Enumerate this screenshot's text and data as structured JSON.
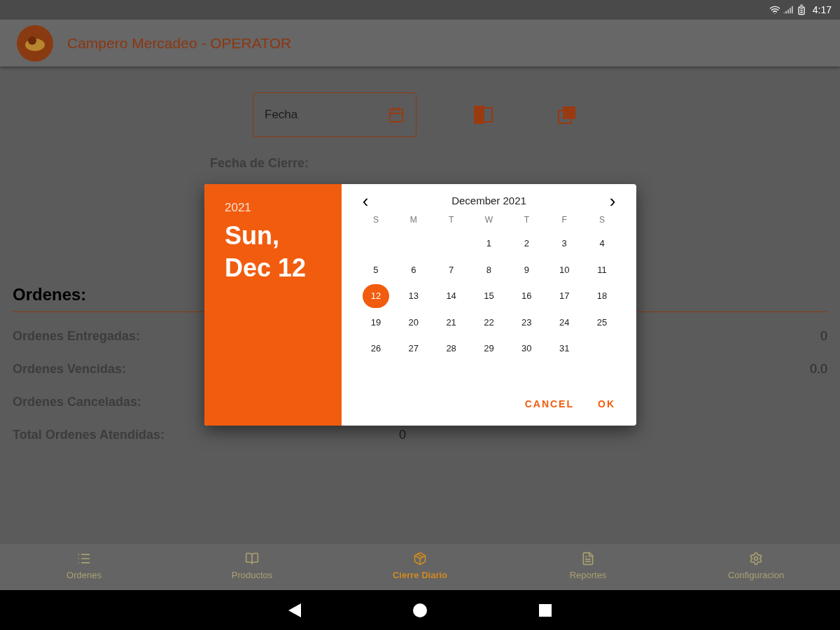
{
  "status_bar": {
    "time": "4:17"
  },
  "app_bar": {
    "title": "Campero Mercadeo - OPERATOR"
  },
  "date_field": {
    "placeholder": "Fecha"
  },
  "closing_date_label": "Fecha de Cierre:",
  "orders": {
    "heading": "Ordenes:",
    "rows": [
      {
        "label": "Ordenes Entregadas:",
        "value": "0"
      },
      {
        "label": "Ordenes Vencidas:",
        "value": "0.0"
      },
      {
        "label": "Ordenes Canceladas:"
      },
      {
        "label": "Total Ordenes Atendidas:",
        "value": "0"
      }
    ]
  },
  "date_picker": {
    "year": "2021",
    "date_line_1": "Sun,",
    "date_line_2": "Dec 12",
    "month": "December 2021",
    "prev": "‹",
    "next": "›",
    "weekdays": [
      "S",
      "M",
      "T",
      "W",
      "T",
      "F",
      "S"
    ],
    "days": [
      {
        "day": "1",
        "selected": false
      },
      {
        "day": "2",
        "selected": false
      },
      {
        "day": "3",
        "selected": false
      },
      {
        "day": "4",
        "selected": false
      },
      {
        "day": "5",
        "selected": false
      },
      {
        "day": "6",
        "selected": false
      },
      {
        "day": "7",
        "selected": false
      },
      {
        "day": "8",
        "selected": false
      },
      {
        "day": "9",
        "selected": false
      },
      {
        "day": "10",
        "selected": false
      },
      {
        "day": "11",
        "selected": false
      },
      {
        "day": "12",
        "selected": true
      },
      {
        "day": "13",
        "selected": false
      },
      {
        "day": "14",
        "selected": false
      },
      {
        "day": "15",
        "selected": false
      },
      {
        "day": "16",
        "selected": false
      },
      {
        "day": "17",
        "selected": false
      },
      {
        "day": "18",
        "selected": false
      },
      {
        "day": "19",
        "selected": false
      },
      {
        "day": "20",
        "selected": false
      },
      {
        "day": "21",
        "selected": false
      },
      {
        "day": "22",
        "selected": false
      },
      {
        "day": "23",
        "selected": false
      },
      {
        "day": "24",
        "selected": false
      },
      {
        "day": "25",
        "selected": false
      },
      {
        "day": "26",
        "selected": false
      },
      {
        "day": "27",
        "selected": false
      },
      {
        "day": "28",
        "selected": false
      },
      {
        "day": "29",
        "selected": false
      },
      {
        "day": "30",
        "selected": false
      },
      {
        "day": "31",
        "selected": false
      }
    ],
    "buttons": [
      "CANCEL",
      "OK"
    ]
  },
  "bottom_nav": [
    {
      "label": "Ordenes",
      "selected": false
    },
    {
      "label": "Productos",
      "selected": false
    },
    {
      "label": "Cierre Diario",
      "selected": true
    },
    {
      "label": "Reportes",
      "selected": false
    },
    {
      "label": "Configuracion",
      "selected": false
    }
  ]
}
